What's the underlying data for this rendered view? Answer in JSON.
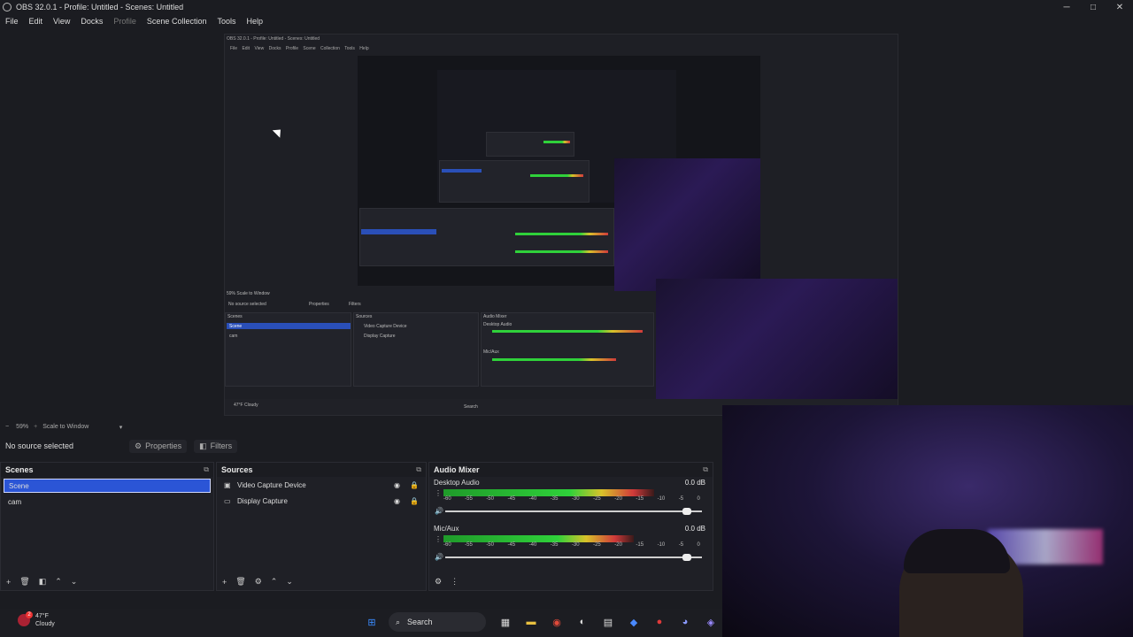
{
  "window": {
    "title": "OBS 32.0.1 - Profile: Untitled - Scenes: Untitled",
    "minimize": "─",
    "maximize": "□",
    "close": "✕"
  },
  "menu": [
    "File",
    "Edit",
    "View",
    "Docks",
    "Profile",
    "Scene Collection",
    "Tools",
    "Help"
  ],
  "nested": {
    "title": "OBS 32.0.1 - Profile: Untitled - Scenes: Untitled",
    "menu": "File Edit View Docks Profile Scene Collection Tools Help",
    "zoom_row": "59%   Scale to Window",
    "no_source": "No source selected",
    "properties": "Properties",
    "filters": "Filters",
    "scenes": "Scenes",
    "sources": "Sources",
    "mixer": "Audio Mixer",
    "scene_items": [
      "Scene",
      "cam"
    ],
    "source_items": [
      "Video Capture Device",
      "Display Capture"
    ],
    "desktop_audio": "Desktop Audio",
    "mic_aux": "Mic/Aux",
    "search": "Search",
    "weather": "47°F Cloudy"
  },
  "preview_toolbar": {
    "zoom": "59%",
    "scale": "Scale to Window"
  },
  "source_bar": {
    "no_source": "No source selected",
    "properties": "Properties",
    "filters": "Filters",
    "properties_icon": "⚙",
    "filters_icon": "◧"
  },
  "scenes_dock": {
    "title": "Scenes",
    "items": [
      "Scene",
      "cam"
    ],
    "selected": "Scene"
  },
  "sources_dock": {
    "title": "Sources",
    "items": [
      {
        "label": "Video Capture Device",
        "icon": "camera-icon"
      },
      {
        "label": "Display Capture",
        "icon": "monitor-icon"
      }
    ]
  },
  "mixer_dock": {
    "title": "Audio Mixer",
    "channels": [
      {
        "name": "Desktop Audio",
        "db": "0.0 dB",
        "level": 0.82
      },
      {
        "name": "Mic/Aux",
        "db": "0.0 dB",
        "level": 0.74
      }
    ],
    "ticks": [
      "-60",
      "-55",
      "-50",
      "-45",
      "-40",
      "-35",
      "-30",
      "-25",
      "-20",
      "-15",
      "-10",
      "-5",
      "0"
    ]
  },
  "taskbar": {
    "weather_temp": "47°F",
    "weather_desc": "Cloudy",
    "notification_count": "2",
    "search": "Search"
  },
  "colors": {
    "accent": "#2b55d6",
    "background": "#1b1c21",
    "panel": "#1f2026"
  }
}
